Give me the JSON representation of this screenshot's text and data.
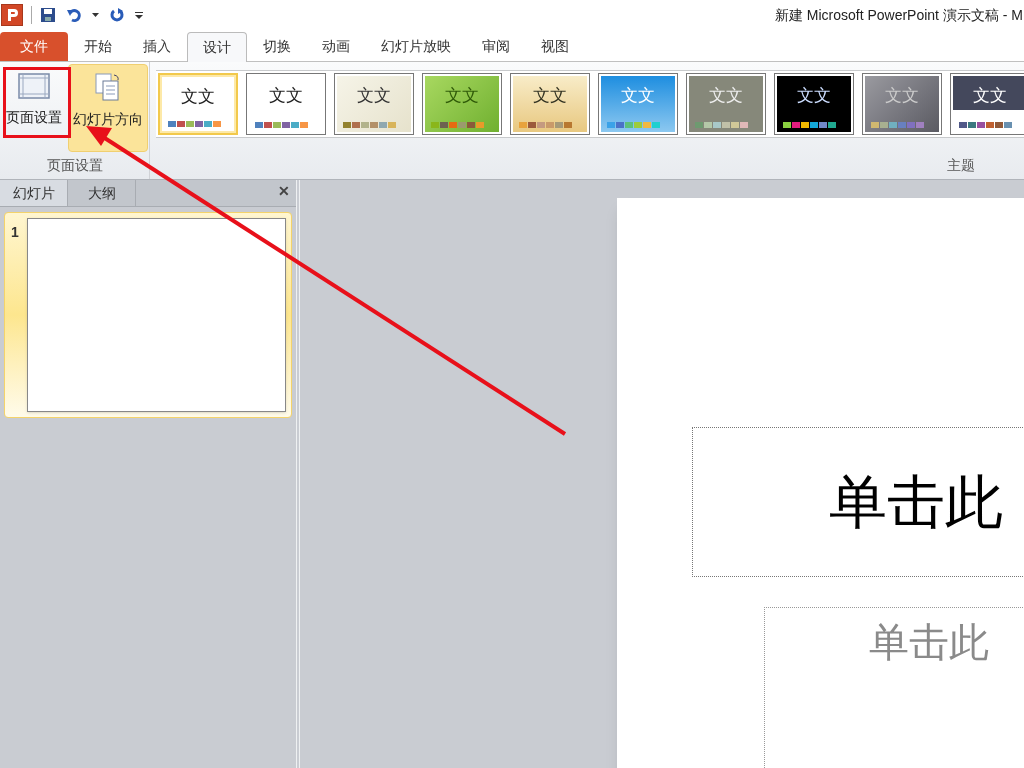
{
  "window": {
    "title": "新建 Microsoft PowerPoint 演示文稿 - M"
  },
  "quick_access": [
    {
      "kind": "save"
    },
    {
      "kind": "undo"
    },
    {
      "kind": "dropdown"
    },
    {
      "kind": "redo"
    },
    {
      "kind": "customize"
    }
  ],
  "ribbon_tabs": [
    {
      "label": "文件",
      "kind": "file",
      "selected": false
    },
    {
      "label": "开始",
      "kind": "tab",
      "selected": false
    },
    {
      "label": "插入",
      "kind": "tab",
      "selected": false
    },
    {
      "label": "设计",
      "kind": "tab",
      "selected": true
    },
    {
      "label": "切换",
      "kind": "tab",
      "selected": false
    },
    {
      "label": "动画",
      "kind": "tab",
      "selected": false
    },
    {
      "label": "幻灯片放映",
      "kind": "tab",
      "selected": false
    },
    {
      "label": "审阅",
      "kind": "tab",
      "selected": false
    },
    {
      "label": "视图",
      "kind": "tab",
      "selected": false
    }
  ],
  "page_setup_group": {
    "label": "页面设置",
    "buttons": [
      {
        "label": "页面设置",
        "kind": "page-setup",
        "highlighted": false
      },
      {
        "label": "幻灯片方向",
        "kind": "orientation",
        "highlighted": true
      }
    ]
  },
  "themes_group": {
    "label": "主题",
    "themes": [
      {
        "kind": "white",
        "selected": true,
        "swatches": [
          {
            "color": "#4f81bd"
          },
          {
            "color": "#c0504d"
          },
          {
            "color": "#9bbb59"
          },
          {
            "color": "#8064a2"
          },
          {
            "color": "#4bacc6"
          },
          {
            "color": "#f79646"
          }
        ]
      },
      {
        "kind": "white",
        "selected": false,
        "swatches": [
          {
            "color": "#4f81bd"
          },
          {
            "color": "#c0504d"
          },
          {
            "color": "#9bbb59"
          },
          {
            "color": "#8064a2"
          },
          {
            "color": "#4bacc6"
          },
          {
            "color": "#f79646"
          }
        ]
      },
      {
        "kind": "paper",
        "selected": false,
        "swatches": [
          {
            "color": "#93822e"
          },
          {
            "color": "#b0704e"
          },
          {
            "color": "#b2b38c"
          },
          {
            "color": "#b39068"
          },
          {
            "color": "#8fa8b0"
          },
          {
            "color": "#d8b45a"
          }
        ]
      },
      {
        "kind": "green",
        "selected": false,
        "swatches": [
          {
            "color": "#8ab61a"
          },
          {
            "color": "#6d6250"
          },
          {
            "color": "#e66b12"
          },
          {
            "color": "#9b9b6e"
          },
          {
            "color": "#8a5a3a"
          },
          {
            "color": "#e89a2a"
          }
        ]
      },
      {
        "kind": "gold",
        "selected": false,
        "swatches": [
          {
            "color": "#e8a33c"
          },
          {
            "color": "#9c5a3c"
          },
          {
            "color": "#c49a80"
          },
          {
            "color": "#c99a6a"
          },
          {
            "color": "#a69a78"
          },
          {
            "color": "#b87830"
          }
        ]
      },
      {
        "kind": "blue",
        "selected": false,
        "swatches": [
          {
            "color": "#3aa2e8"
          },
          {
            "color": "#4a72c8"
          },
          {
            "color": "#5cc07c"
          },
          {
            "color": "#9ccc3c"
          },
          {
            "color": "#f0b840"
          },
          {
            "color": "#1fd0d0"
          }
        ]
      },
      {
        "kind": "olive",
        "selected": false,
        "swatches": [
          {
            "color": "#6e9a70"
          },
          {
            "color": "#b4c8a8"
          },
          {
            "color": "#a8c8c8"
          },
          {
            "color": "#c0c0a8"
          },
          {
            "color": "#d0c898"
          },
          {
            "color": "#e0b8b8"
          }
        ]
      },
      {
        "kind": "black",
        "selected": false,
        "swatches": [
          {
            "color": "#8ad040"
          },
          {
            "color": "#e01c7c"
          },
          {
            "color": "#f0b800"
          },
          {
            "color": "#14a8d8"
          },
          {
            "color": "#7088c8"
          },
          {
            "color": "#20a890"
          }
        ]
      },
      {
        "kind": "gray",
        "selected": false,
        "swatches": [
          {
            "color": "#d0b870"
          },
          {
            "color": "#a8b090"
          },
          {
            "color": "#70b0c0"
          },
          {
            "color": "#6880c0"
          },
          {
            "color": "#8070c0"
          },
          {
            "color": "#a080c0"
          }
        ]
      },
      {
        "kind": "navy",
        "selected": false,
        "swatches": [
          {
            "color": "#505888"
          },
          {
            "color": "#3c7880"
          },
          {
            "color": "#9850a0"
          },
          {
            "color": "#c06030"
          },
          {
            "color": "#905838"
          },
          {
            "color": "#6890b0"
          }
        ]
      }
    ]
  },
  "theme_samples": [
    "文文",
    "文文",
    "文文",
    "文文",
    "文文",
    "文文",
    "文文",
    "文文",
    "文文",
    "文文"
  ],
  "side_panel": {
    "tabs": [
      {
        "label": "幻灯片",
        "selected": true
      },
      {
        "label": "大纲",
        "selected": false
      }
    ],
    "close": "✕",
    "slides": [
      {
        "number": "1",
        "selected": true
      }
    ]
  },
  "slide": {
    "title_placeholder": "单击此",
    "subtitle_placeholder": "单击此"
  },
  "annotations": {
    "highlight_frame": true,
    "arrow": true
  }
}
